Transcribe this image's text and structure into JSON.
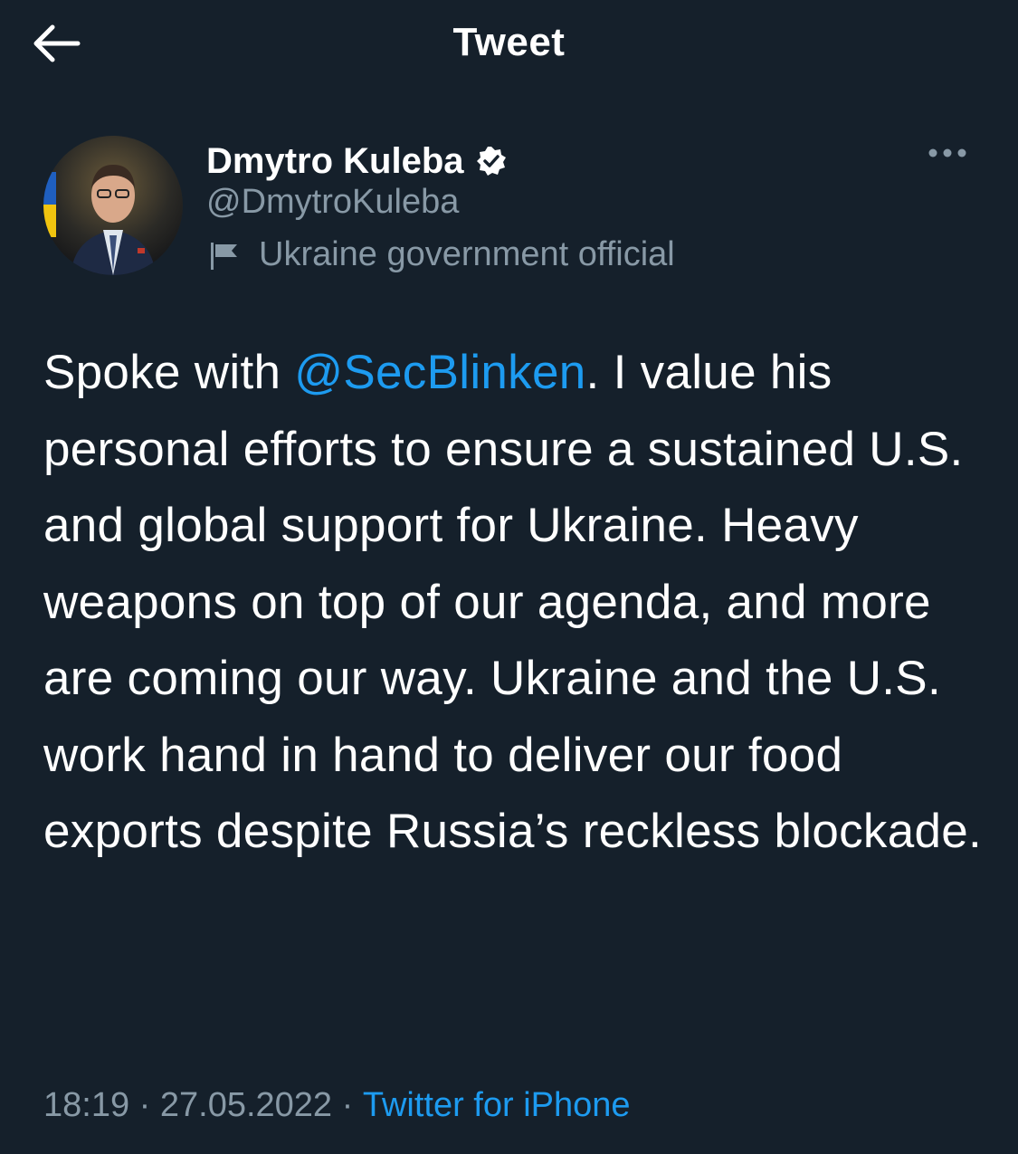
{
  "header": {
    "title": "Tweet",
    "back_icon": "arrow-left-icon"
  },
  "author": {
    "name": "Dmytro Kuleba",
    "handle": "@DmytroKuleba",
    "label": "Ukraine government official",
    "verified_icon": "verified-badge-icon",
    "label_icon": "flag-icon",
    "more_icon": "more-horizontal-icon"
  },
  "tweet": {
    "text_before": "Spoke with ",
    "mention": "@SecBlinken",
    "text_after": ". I value his personal efforts to ensure a sustained U.S. and global support for Ukraine. Heavy weapons on top of our agenda, and more are coming our way. Ukraine and the U.S. work hand in hand to deliver our food exports despite Russia’s reckless blockade."
  },
  "meta": {
    "time": "18:19",
    "separator": " · ",
    "date": "27.05.2022",
    "source": "Twitter for iPhone"
  },
  "colors": {
    "background": "#15202b",
    "link": "#1d9bf0",
    "secondary_text": "#8899a6"
  }
}
